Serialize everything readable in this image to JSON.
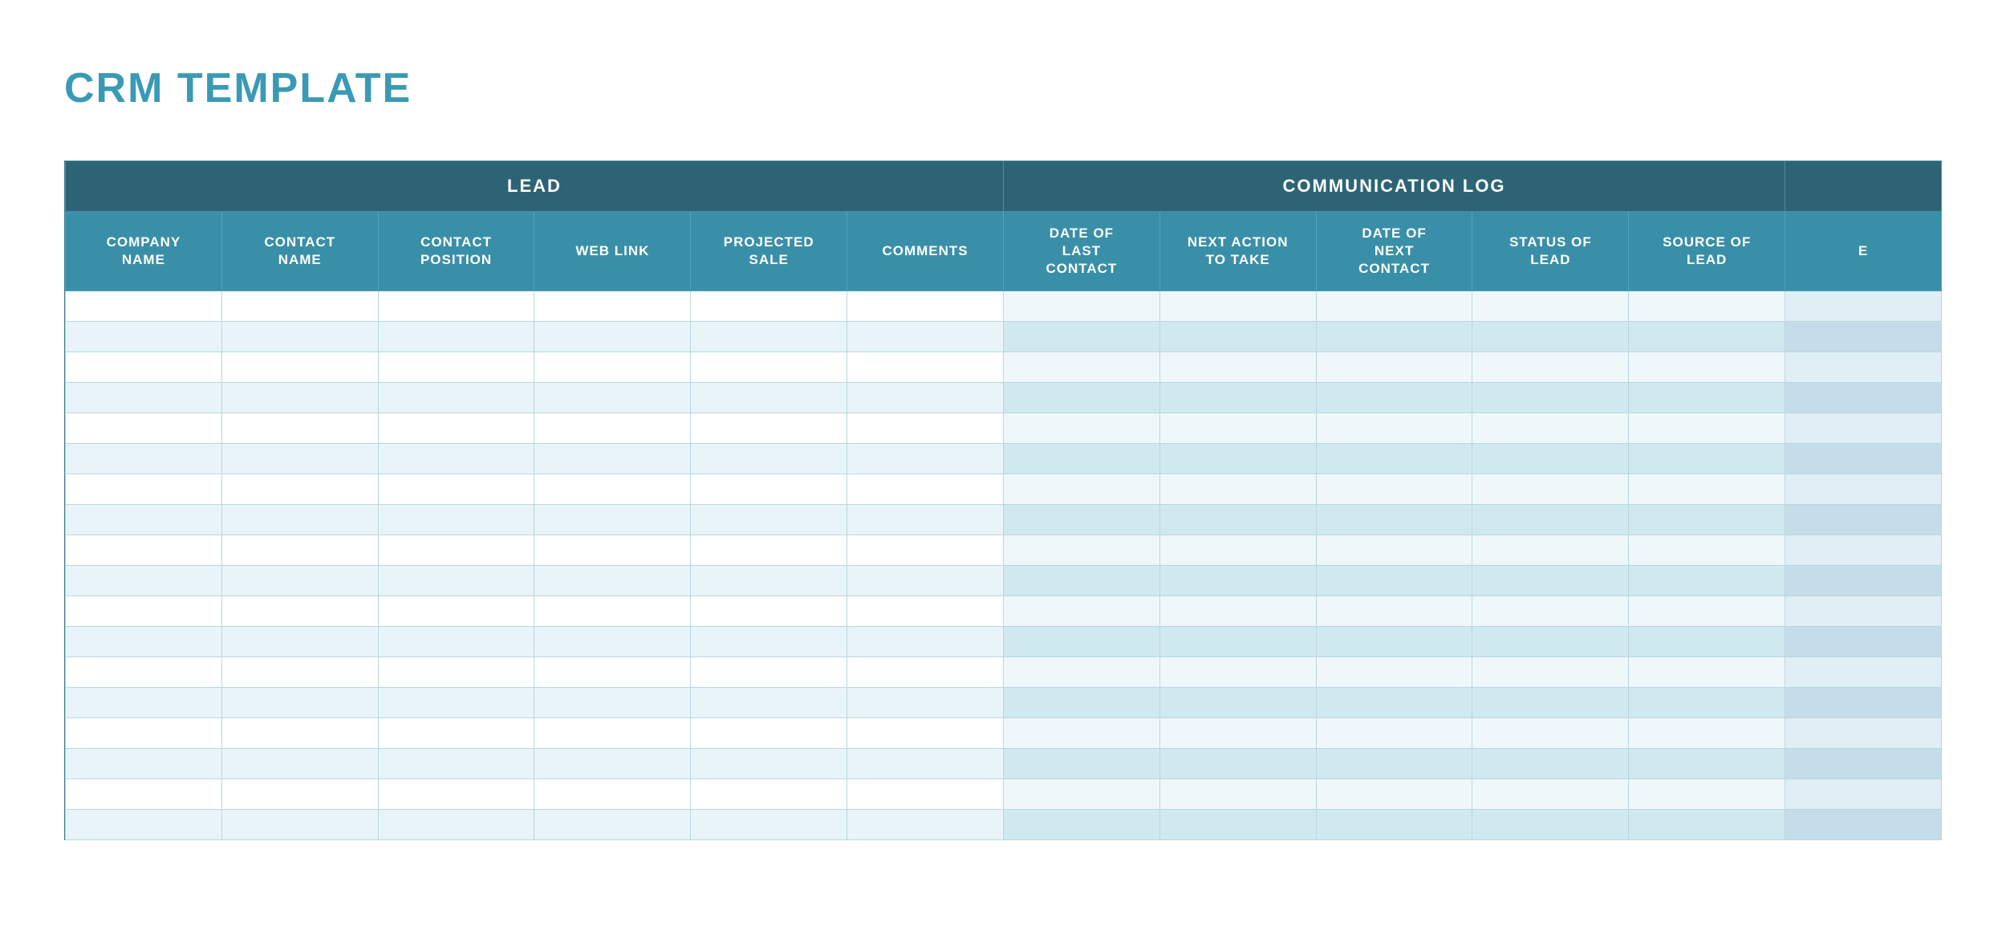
{
  "title": "CRM TEMPLATE",
  "groups": [
    {
      "label": "LEAD",
      "colspan": 6
    },
    {
      "label": "COMMUNICATION LOG",
      "colspan": 5
    },
    {
      "label": "",
      "colspan": 1
    }
  ],
  "columns": [
    {
      "key": "company_name",
      "label": "COMPANY\nNAME",
      "class": "lead-col col-company"
    },
    {
      "key": "contact_name",
      "label": "CONTACT\nNAME",
      "class": "lead-col col-cname"
    },
    {
      "key": "contact_position",
      "label": "CONTACT\nPOSITION",
      "class": "lead-col col-cpos"
    },
    {
      "key": "web_link",
      "label": "WEB LINK",
      "class": "lead-col col-weblink"
    },
    {
      "key": "projected_sale",
      "label": "PROJECTED\nSALE",
      "class": "lead-col col-projsale"
    },
    {
      "key": "comments",
      "label": "COMMENTS",
      "class": "lead-col col-comments"
    },
    {
      "key": "date_last_contact",
      "label": "DATE OF\nLAST\nCONTACT",
      "class": "comm-col col-dlast"
    },
    {
      "key": "next_action",
      "label": "NEXT ACTION\nTO TAKE",
      "class": "comm-col col-nextact"
    },
    {
      "key": "date_next_contact",
      "label": "DATE OF\nNEXT\nCONTACT",
      "class": "comm-col col-dnext"
    },
    {
      "key": "status_lead",
      "label": "STATUS OF\nLEAD",
      "class": "comm-col col-status"
    },
    {
      "key": "source_lead",
      "label": "SOURCE OF\nLEAD",
      "class": "comm-col col-source"
    },
    {
      "key": "extra",
      "label": "E",
      "class": "extra-col col-extra"
    }
  ],
  "num_rows": 18
}
